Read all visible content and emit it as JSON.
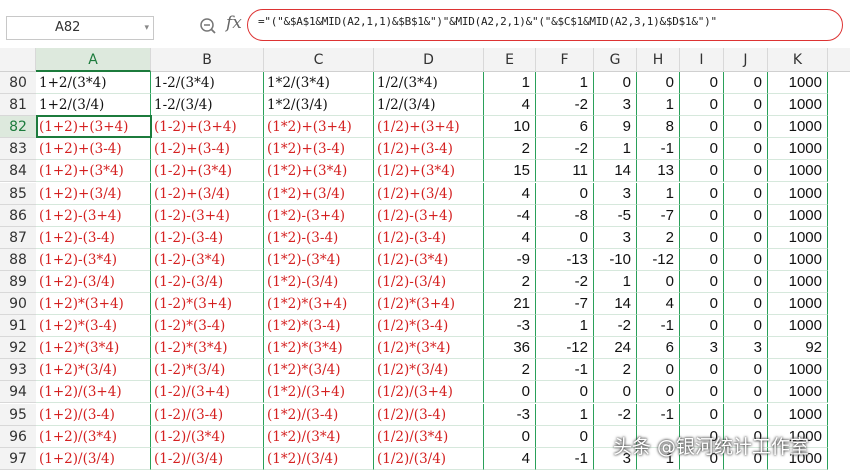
{
  "name_box": "A82",
  "formula": "=\"(\"&$A$1&MID(A2,1,1)&$B$1&\")\"&MID(A2,2,1)&\"(\"&$C$1&MID(A2,3,1)&$D$1&\")\"",
  "columns": [
    "A",
    "B",
    "C",
    "D",
    "E",
    "F",
    "G",
    "H",
    "I",
    "J",
    "K"
  ],
  "rows": [
    {
      "n": "80",
      "a": "1+2/(3*4)",
      "b": "1-2/(3*4)",
      "c": "1*2/(3*4)",
      "d": "1/2/(3*4)",
      "e": "1",
      "f": "1",
      "g": "0",
      "h": "0",
      "i": "0",
      "j": "0",
      "k": "1000",
      "red": false
    },
    {
      "n": "81",
      "a": "1+2/(3/4)",
      "b": "1-2/(3/4)",
      "c": "1*2/(3/4)",
      "d": "1/2/(3/4)",
      "e": "4",
      "f": "-2",
      "g": "3",
      "h": "1",
      "i": "0",
      "j": "0",
      "k": "1000",
      "red": false
    },
    {
      "n": "82",
      "a": "(1+2)+(3+4)",
      "b": "(1-2)+(3+4)",
      "c": "(1*2)+(3+4)",
      "d": "(1/2)+(3+4)",
      "e": "10",
      "f": "6",
      "g": "9",
      "h": "8",
      "i": "0",
      "j": "0",
      "k": "1000",
      "red": true
    },
    {
      "n": "83",
      "a": "(1+2)+(3-4)",
      "b": "(1-2)+(3-4)",
      "c": "(1*2)+(3-4)",
      "d": "(1/2)+(3-4)",
      "e": "2",
      "f": "-2",
      "g": "1",
      "h": "-1",
      "i": "0",
      "j": "0",
      "k": "1000",
      "red": true
    },
    {
      "n": "84",
      "a": "(1+2)+(3*4)",
      "b": "(1-2)+(3*4)",
      "c": "(1*2)+(3*4)",
      "d": "(1/2)+(3*4)",
      "e": "15",
      "f": "11",
      "g": "14",
      "h": "13",
      "i": "0",
      "j": "0",
      "k": "1000",
      "red": true
    },
    {
      "n": "85",
      "a": "(1+2)+(3/4)",
      "b": "(1-2)+(3/4)",
      "c": "(1*2)+(3/4)",
      "d": "(1/2)+(3/4)",
      "e": "4",
      "f": "0",
      "g": "3",
      "h": "1",
      "i": "0",
      "j": "0",
      "k": "1000",
      "red": true
    },
    {
      "n": "86",
      "a": "(1+2)-(3+4)",
      "b": "(1-2)-(3+4)",
      "c": "(1*2)-(3+4)",
      "d": "(1/2)-(3+4)",
      "e": "-4",
      "f": "-8",
      "g": "-5",
      "h": "-7",
      "i": "0",
      "j": "0",
      "k": "1000",
      "red": true
    },
    {
      "n": "87",
      "a": "(1+2)-(3-4)",
      "b": "(1-2)-(3-4)",
      "c": "(1*2)-(3-4)",
      "d": "(1/2)-(3-4)",
      "e": "4",
      "f": "0",
      "g": "3",
      "h": "2",
      "i": "0",
      "j": "0",
      "k": "1000",
      "red": true
    },
    {
      "n": "88",
      "a": "(1+2)-(3*4)",
      "b": "(1-2)-(3*4)",
      "c": "(1*2)-(3*4)",
      "d": "(1/2)-(3*4)",
      "e": "-9",
      "f": "-13",
      "g": "-10",
      "h": "-12",
      "i": "0",
      "j": "0",
      "k": "1000",
      "red": true
    },
    {
      "n": "89",
      "a": "(1+2)-(3/4)",
      "b": "(1-2)-(3/4)",
      "c": "(1*2)-(3/4)",
      "d": "(1/2)-(3/4)",
      "e": "2",
      "f": "-2",
      "g": "1",
      "h": "0",
      "i": "0",
      "j": "0",
      "k": "1000",
      "red": true
    },
    {
      "n": "90",
      "a": "(1+2)*(3+4)",
      "b": "(1-2)*(3+4)",
      "c": "(1*2)*(3+4)",
      "d": "(1/2)*(3+4)",
      "e": "21",
      "f": "-7",
      "g": "14",
      "h": "4",
      "i": "0",
      "j": "0",
      "k": "1000",
      "red": true
    },
    {
      "n": "91",
      "a": "(1+2)*(3-4)",
      "b": "(1-2)*(3-4)",
      "c": "(1*2)*(3-4)",
      "d": "(1/2)*(3-4)",
      "e": "-3",
      "f": "1",
      "g": "-2",
      "h": "-1",
      "i": "0",
      "j": "0",
      "k": "1000",
      "red": true
    },
    {
      "n": "92",
      "a": "(1+2)*(3*4)",
      "b": "(1-2)*(3*4)",
      "c": "(1*2)*(3*4)",
      "d": "(1/2)*(3*4)",
      "e": "36",
      "f": "-12",
      "g": "24",
      "h": "6",
      "i": "3",
      "j": "3",
      "k": "92",
      "red": true
    },
    {
      "n": "93",
      "a": "(1+2)*(3/4)",
      "b": "(1-2)*(3/4)",
      "c": "(1*2)*(3/4)",
      "d": "(1/2)*(3/4)",
      "e": "2",
      "f": "-1",
      "g": "2",
      "h": "0",
      "i": "0",
      "j": "0",
      "k": "1000",
      "red": true
    },
    {
      "n": "94",
      "a": "(1+2)/(3+4)",
      "b": "(1-2)/(3+4)",
      "c": "(1*2)/(3+4)",
      "d": "(1/2)/(3+4)",
      "e": "0",
      "f": "0",
      "g": "0",
      "h": "0",
      "i": "0",
      "j": "0",
      "k": "1000",
      "red": true
    },
    {
      "n": "95",
      "a": "(1+2)/(3-4)",
      "b": "(1-2)/(3-4)",
      "c": "(1*2)/(3-4)",
      "d": "(1/2)/(3-4)",
      "e": "-3",
      "f": "1",
      "g": "-2",
      "h": "-1",
      "i": "0",
      "j": "0",
      "k": "1000",
      "red": true
    },
    {
      "n": "96",
      "a": "(1+2)/(3*4)",
      "b": "(1-2)/(3*4)",
      "c": "(1*2)/(3*4)",
      "d": "(1/2)/(3*4)",
      "e": "0",
      "f": "0",
      "g": "",
      "h": "",
      "i": "0",
      "j": "0",
      "k": "1000",
      "red": true
    },
    {
      "n": "97",
      "a": "(1+2)/(3/4)",
      "b": "(1-2)/(3/4)",
      "c": "(1*2)/(3/4)",
      "d": "(1/2)/(3/4)",
      "e": "4",
      "f": "-1",
      "g": "3",
      "h": "1",
      "i": "0",
      "j": "0",
      "k": "1000",
      "red": true
    }
  ],
  "watermark": "头条 @银河统计工作室",
  "icons": {
    "zoom": "zoom-search-icon",
    "fx": "fx-icon",
    "dropdown": "chevron-down-icon"
  },
  "colors": {
    "accent_green": "#1c7b3c",
    "formula_text_red": "#d42020",
    "highlight_circle": "#dd3333"
  }
}
